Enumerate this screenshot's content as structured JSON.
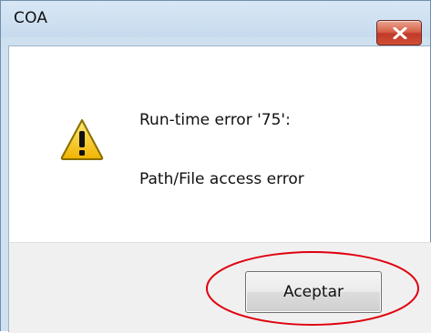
{
  "window": {
    "title": "COA"
  },
  "message": {
    "line1": "Run-time error '75':",
    "line2": "Path/File access error"
  },
  "buttons": {
    "ok_label": "Aceptar"
  },
  "icons": {
    "dialog_icon": "warning-icon",
    "close_icon": "close-icon"
  },
  "colors": {
    "highlight": "#e0000e",
    "close_button": "#c0392b",
    "warning_fill": "#f5c518"
  }
}
